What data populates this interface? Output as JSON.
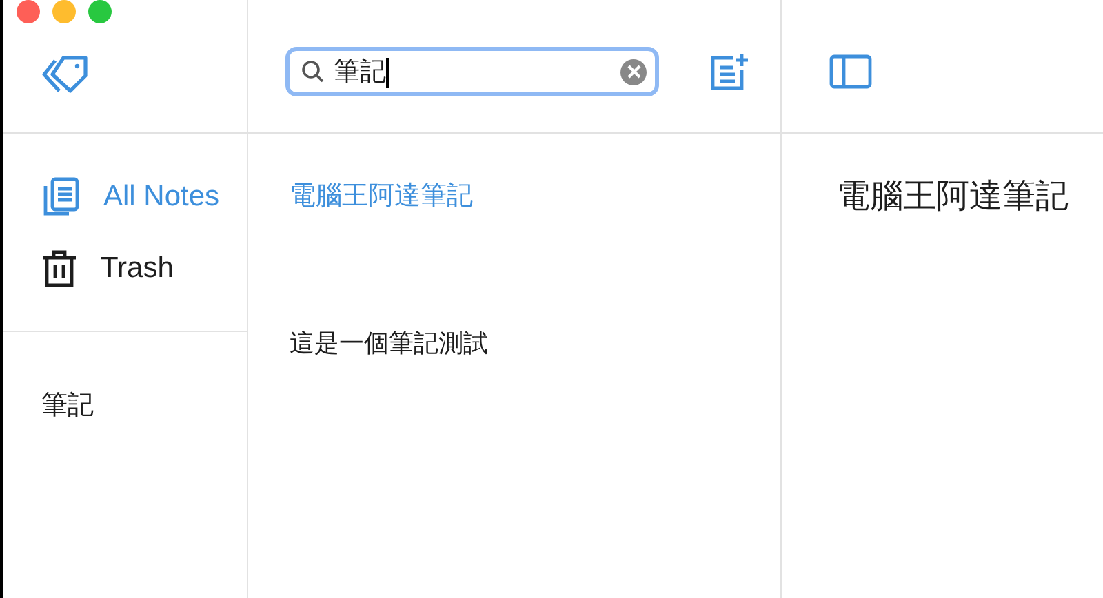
{
  "window": {
    "controls": [
      {
        "color": "#fe5f57"
      },
      {
        "color": "#febc2e"
      },
      {
        "color": "#28c840"
      }
    ]
  },
  "sidebar": {
    "items": [
      {
        "kind": "notes",
        "label": "All Notes",
        "selected": true
      },
      {
        "kind": "trash",
        "label": "Trash",
        "selected": false
      }
    ],
    "tags": [
      {
        "label": "筆記",
        "selected": false
      }
    ]
  },
  "search": {
    "value": "筆記",
    "focused": true
  },
  "notes": [
    {
      "title": "電腦王阿達筆記",
      "preview": "這是一個筆記測試",
      "selected": true
    }
  ],
  "editor": {
    "title": "電腦王阿達筆記"
  }
}
